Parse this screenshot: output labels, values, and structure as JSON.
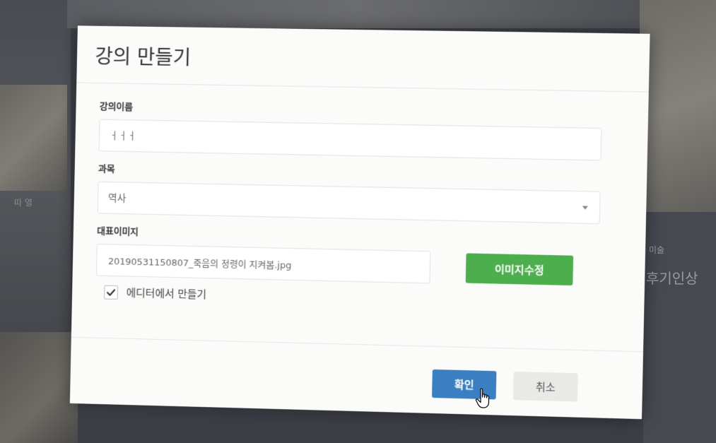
{
  "background": {
    "left_label": "따 열",
    "right_category": "미술",
    "right_title": "후기인상"
  },
  "modal": {
    "title": "강의 만들기",
    "course_name": {
      "label": "강의이름",
      "value": "ㅓㅓㅓ"
    },
    "subject": {
      "label": "과목",
      "selected": "역사"
    },
    "cover_image": {
      "label": "대표이미지",
      "filename": "20190531150807_죽음의 정령이 지켜봄.jpg",
      "edit_button": "이미지수정"
    },
    "editor_checkbox": {
      "label": "에디터에서 만들기",
      "checked": true
    },
    "buttons": {
      "confirm": "확인",
      "cancel": "취소"
    }
  },
  "colors": {
    "confirm": "#3a7fc1",
    "image_edit": "#4cae4c",
    "cancel": "#e9e9e7"
  }
}
